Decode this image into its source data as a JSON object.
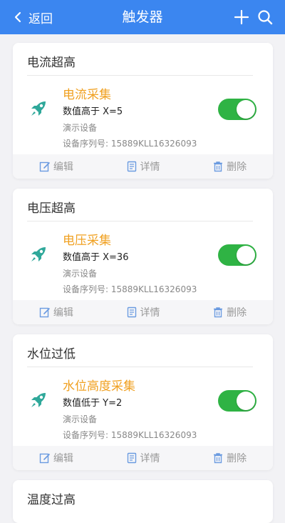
{
  "navbar": {
    "back_label": "返回",
    "title": "触发器",
    "background_color": "#3b86f0",
    "icons": [
      "chevron-left-icon",
      "plus-icon",
      "search-icon"
    ]
  },
  "actions": {
    "edit_label": "编辑",
    "detail_label": "详情",
    "delete_label": "删除"
  },
  "triggers": [
    {
      "title": "电流超高",
      "item_name": "电流采集",
      "condition": "数值高于 X=5",
      "device": "演示设备",
      "serial": "设备序列号: 15889KLL16326093",
      "enabled": true
    },
    {
      "title": "电压超高",
      "item_name": "电压采集",
      "condition": "数值高于 X=36",
      "device": "演示设备",
      "serial": "设备序列号: 15889KLL16326093",
      "enabled": true
    },
    {
      "title": "水位过低",
      "item_name": "水位高度采集",
      "condition": "数值低于 Y=2",
      "device": "演示设备",
      "serial": "设备序列号: 15889KLL16326093",
      "enabled": true
    },
    {
      "title": "温度过高"
    }
  ],
  "colors": {
    "item_name": "#f0a020",
    "toggle_on": "#2fb344",
    "rocket_icon": "#2fa89a"
  }
}
